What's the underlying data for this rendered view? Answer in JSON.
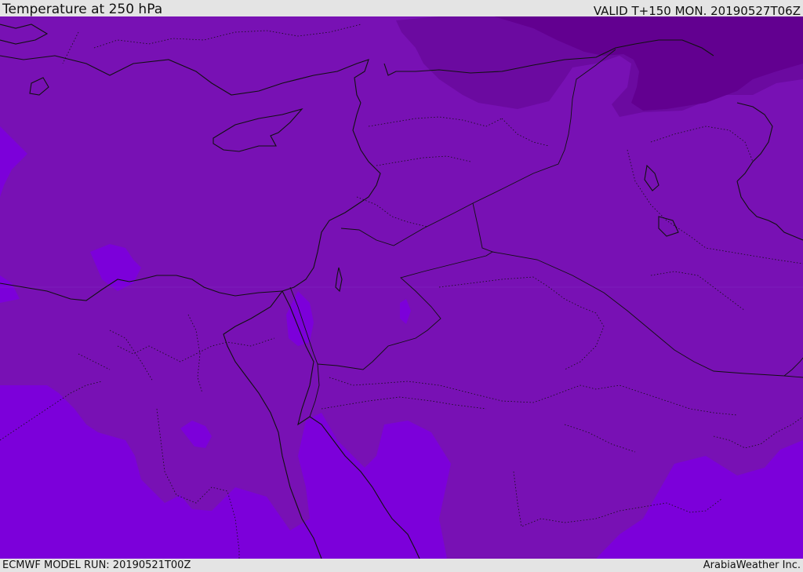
{
  "header": {
    "title": "Temperature at 250 hPa",
    "valid_time": "VALID T+150 MON. 20190527T06Z"
  },
  "footer": {
    "model_run": "ECMWF MODEL RUN: 20190521T00Z",
    "credit": "ArabiaWeather Inc."
  },
  "map": {
    "colors": {
      "warm_band": "#7c00da",
      "mid_band": "#7811b4",
      "cold_band": "#6b0aa0",
      "coldest_band": "#620090",
      "borders": "#111111"
    }
  }
}
